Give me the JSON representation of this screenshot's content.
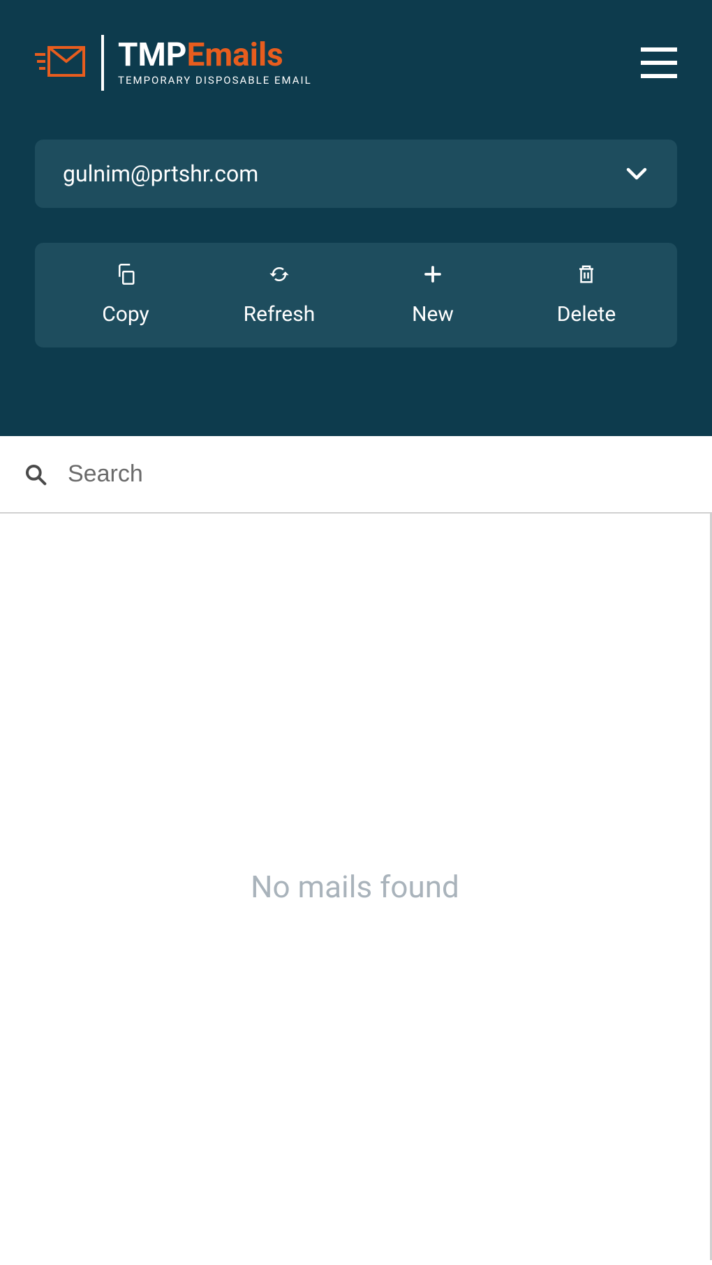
{
  "logo": {
    "title_part1": "TMP",
    "title_part2": "Emails",
    "subtitle": "TEMPORARY DISPOSABLE EMAIL"
  },
  "email": {
    "current": "gulnim@prtshr.com"
  },
  "actions": {
    "copy": "Copy",
    "refresh": "Refresh",
    "new": "New",
    "delete": "Delete"
  },
  "search": {
    "placeholder": "Search"
  },
  "content": {
    "empty_message": "No mails found"
  }
}
